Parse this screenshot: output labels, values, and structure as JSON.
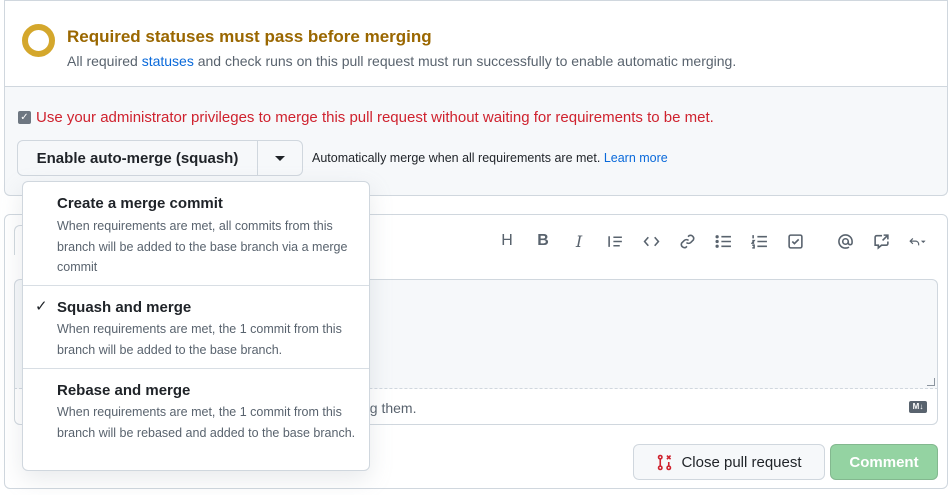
{
  "status": {
    "title": "Required statuses must pass before merging",
    "desc_before": "All required ",
    "desc_link": "statuses",
    "desc_after": " and check runs on this pull request must run successfully to enable automatic merging.",
    "ring_color": "#d4a72c"
  },
  "admin_override": {
    "checked": true,
    "checkmark": "✓",
    "label": "Use your administrator privileges to merge this pull request without waiting for requirements to be met."
  },
  "automerge": {
    "button_label": "Enable auto-merge (squash)",
    "help_text": "Automatically merge when all requirements are met.",
    "help_link": "Learn more"
  },
  "merge_menu": {
    "items": [
      {
        "title": "Create a merge commit",
        "desc": "When requirements are met, all commits from this branch will be added to the base branch via a merge commit",
        "selected": false
      },
      {
        "title": "Squash and merge",
        "desc": "When requirements are met, the 1 commit from this branch will be added to the base branch.",
        "selected": true
      },
      {
        "title": "Rebase and merge",
        "desc": "When requirements are met, the 1 commit from this branch will be rebased and added to the base branch.",
        "selected": false
      }
    ],
    "check_glyph": "✓"
  },
  "toolbar": {
    "icons": [
      "heading-icon",
      "bold-icon",
      "italic-icon",
      "quote-icon",
      "code-icon",
      "link-icon",
      "bullet-list-icon",
      "numbered-list-icon",
      "task-list-icon",
      "mention-icon",
      "reference-icon",
      "reply-icon"
    ],
    "heading": "H",
    "bold": "B",
    "italic": "I"
  },
  "comment": {
    "footer_text_fragment": "ting them.",
    "markdown_badge": "M↓",
    "close_pr_label": "Close pull request",
    "comment_label": "Comment"
  },
  "colors": {
    "warning": "#9a6700",
    "danger": "#cf222e",
    "link": "#0969da",
    "comment_disabled": "#94d3a2",
    "close_pr_icon": "#cf222e"
  }
}
